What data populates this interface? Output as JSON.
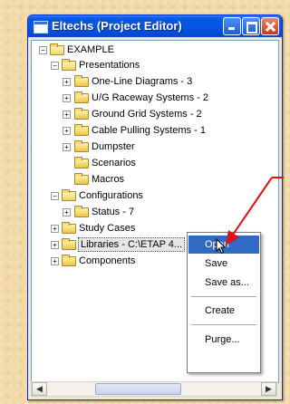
{
  "window": {
    "title": "Eltechs (Project Editor)",
    "title_color": "#0454e6"
  },
  "tree": {
    "root": "EXAMPLE",
    "presentations": "Presentations",
    "one_line": "One-Line Diagrams - 3",
    "ug_raceway": "U/G Raceway Systems - 2",
    "ground_grid": "Ground Grid Systems - 2",
    "cable_pulling": "Cable Pulling Systems - 1",
    "dumpster": "Dumpster",
    "scenarios": "Scenarios",
    "macros": "Macros",
    "configurations": "Configurations",
    "status": "Status - 7",
    "study_cases": "Study Cases",
    "libraries": "Libraries - C:\\ETAP 4...",
    "components": "Components"
  },
  "context_menu": {
    "items": [
      "Open",
      "Save",
      "Save as...",
      "Create",
      "Purge..."
    ],
    "highlight_color": "#316ac5"
  },
  "annotation": {
    "arrow_color": "#e01010"
  }
}
